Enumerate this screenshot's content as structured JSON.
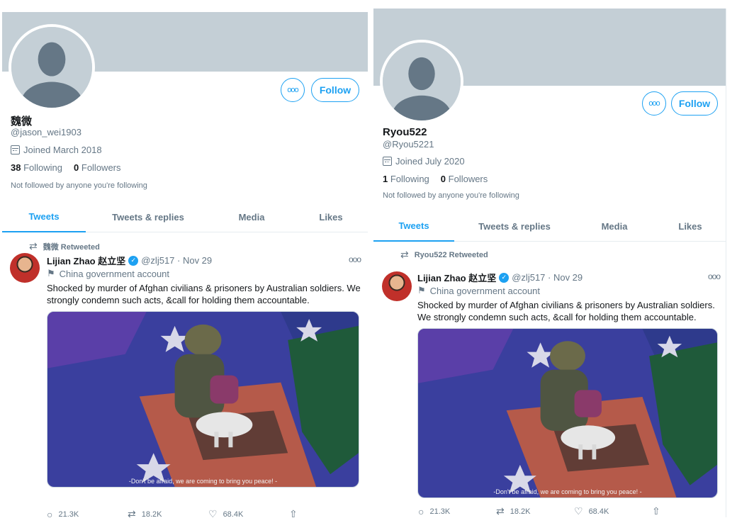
{
  "left": {
    "name": "魏微",
    "handle": "@jason_wei1903",
    "joined": "Joined March 2018",
    "following_count": "38",
    "following_label": "Following",
    "followers_count": "0",
    "followers_label": "Followers",
    "not_followed": "Not followed by anyone you're following",
    "follow_label": "Follow",
    "more_label": "ooo",
    "tabs": [
      "Tweets",
      "Tweets & replies",
      "Media",
      "Likes"
    ],
    "retweeted": "魏微 Retweeted"
  },
  "right": {
    "name": "Ryou522",
    "handle": "@Ryou5221",
    "joined": "Joined July 2020",
    "following_count": "1",
    "following_label": "Following",
    "followers_count": "0",
    "followers_label": "Followers",
    "not_followed": "Not followed by anyone you're following",
    "follow_label": "Follow",
    "more_label": "ooo",
    "tabs": [
      "Tweets",
      "Tweets & replies",
      "Media",
      "Likes"
    ],
    "retweeted": "Ryou522 Retweeted"
  },
  "tweet": {
    "author": "Lijian Zhao 赵立坚",
    "handle_date": "@zlj517 · Nov 29",
    "gov_label": "China government account",
    "text": "Shocked by murder of Afghan civilians & prisoners by Australian soldiers. We strongly condemn such acts, &call for holding them accountable.",
    "caption": "-Don't be afraid, we are coming to bring you peace! -",
    "replies": "21.3K",
    "retweets": "18.2K",
    "likes": "68.4K",
    "more_label": "ooo"
  },
  "icons": {
    "retweet": "retweet-icon",
    "calendar": "calendar-icon",
    "flag": "flag-icon",
    "verified": "verified-badge-icon",
    "reply": "reply-icon",
    "like": "heart-icon",
    "share": "share-icon"
  },
  "colors": {
    "accent": "#1da1f2",
    "banner": "#c4cfd6",
    "secondary_text": "#657786"
  }
}
